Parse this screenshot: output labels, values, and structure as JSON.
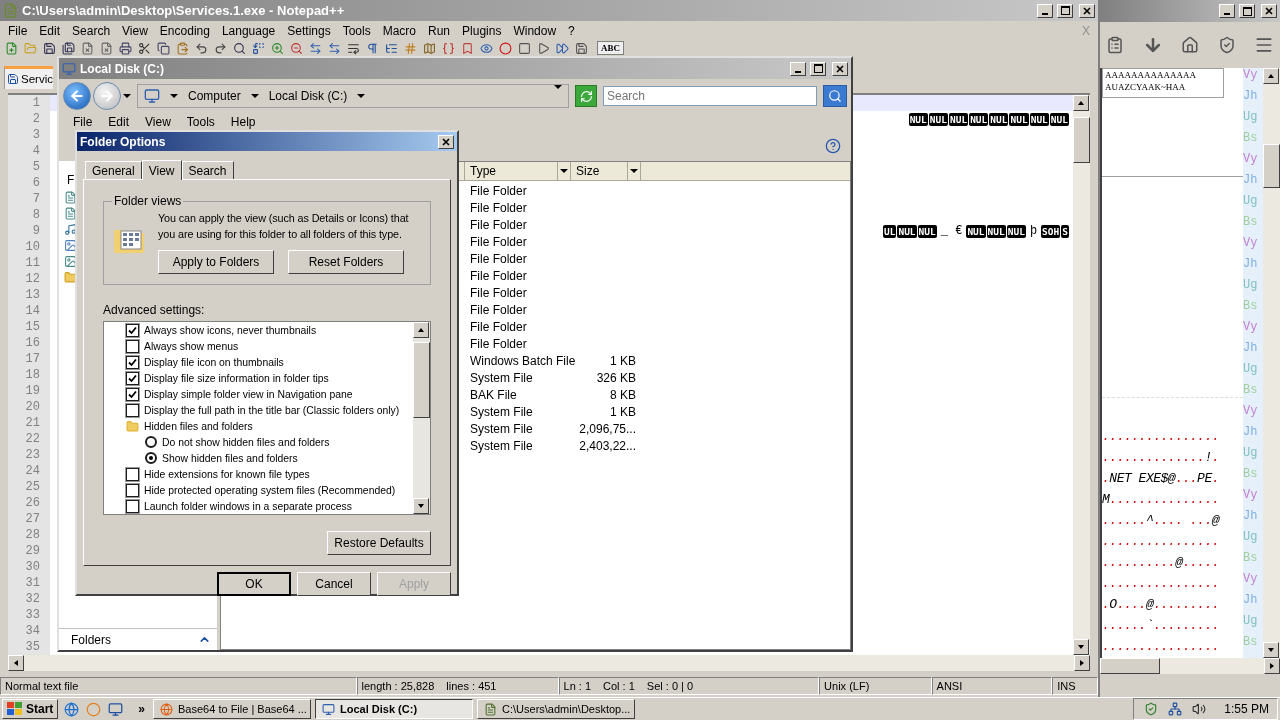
{
  "notepad": {
    "title": "C:\\Users\\admin\\Desktop\\Services.1.exe - Notepad++",
    "menu": [
      "File",
      "Edit",
      "Search",
      "View",
      "Encoding",
      "Language",
      "Settings",
      "Tools",
      "Macro",
      "Run",
      "Plugins",
      "Window",
      "?"
    ],
    "close_document": "X",
    "toolbar_label": "ABC",
    "tab": "Servic",
    "lines": [
      {
        "number": "1",
        "current": true
      },
      {
        "number": "2",
        "current": false,
        "tokens": [
          {
            "kind": "ctrl",
            "text": "NUL"
          },
          {
            "kind": "ctrl",
            "text": "NUL"
          },
          {
            "kind": "ctrl",
            "text": "NUL"
          },
          {
            "kind": "ctrl",
            "text": "NUL"
          },
          {
            "kind": "ctrl",
            "text": "NUL"
          },
          {
            "kind": "ctrl",
            "text": "NUL"
          },
          {
            "kind": "ctrl",
            "text": "NUL"
          },
          {
            "kind": "ctrl",
            "text": "NUL"
          }
        ]
      },
      {
        "number": "3",
        "current": false
      },
      {
        "number": "4",
        "current": false
      },
      {
        "number": "5",
        "current": false
      },
      {
        "number": "6",
        "current": false
      },
      {
        "number": "7",
        "current": false
      },
      {
        "number": "8",
        "current": false
      },
      {
        "number": "9",
        "current": false,
        "tokens": [
          {
            "kind": "ctrl",
            "text": "UL"
          },
          {
            "kind": "ctrl",
            "text": "NUL"
          },
          {
            "kind": "ctrl",
            "text": "NUL"
          },
          {
            "kind": "char",
            "text": "_ €"
          },
          {
            "kind": "ctrl",
            "text": "NUL"
          },
          {
            "kind": "ctrl",
            "text": "NUL"
          },
          {
            "kind": "ctrl",
            "text": "NUL"
          },
          {
            "kind": "char",
            "text": "þ"
          },
          {
            "kind": "ctrl",
            "text": "SOH"
          },
          {
            "kind": "ctrl",
            "text": "S"
          }
        ]
      },
      {
        "number": "10",
        "current": false
      },
      {
        "number": "11",
        "current": false
      },
      {
        "number": "12",
        "current": false
      },
      {
        "number": "13",
        "current": false
      },
      {
        "number": "14",
        "current": false
      },
      {
        "number": "15",
        "current": false
      },
      {
        "number": "16",
        "current": false
      },
      {
        "number": "17",
        "current": false
      },
      {
        "number": "18",
        "current": false
      },
      {
        "number": "19",
        "current": false
      },
      {
        "number": "20",
        "current": false
      },
      {
        "number": "21",
        "current": false
      },
      {
        "number": "22",
        "current": false
      },
      {
        "number": "23",
        "current": false
      },
      {
        "number": "24",
        "current": false
      },
      {
        "number": "25",
        "current": false
      },
      {
        "number": "26",
        "current": false
      },
      {
        "number": "27",
        "current": false
      },
      {
        "number": "28",
        "current": false
      },
      {
        "number": "29",
        "current": false
      },
      {
        "number": "30",
        "current": false
      },
      {
        "number": "31",
        "current": false
      },
      {
        "number": "32",
        "current": false
      },
      {
        "number": "33",
        "current": false
      },
      {
        "number": "34",
        "current": false
      },
      {
        "number": "35",
        "current": false
      }
    ],
    "status": [
      {
        "texts": [
          "Normal text file"
        ]
      },
      {
        "texts": [
          "length : 25,828",
          "lines : 451"
        ]
      },
      {
        "texts": [
          "Ln : 1",
          "Col : 1",
          "Sel : 0 | 0"
        ]
      },
      {
        "texts": [
          "Unix (LF)"
        ]
      },
      {
        "texts": [
          "ANSI"
        ]
      },
      {
        "texts": [
          "INS"
        ]
      }
    ]
  },
  "explorer": {
    "title": "Local Disk (C:)",
    "breadcrumb": [
      "Computer",
      "Local Disk (C:)"
    ],
    "search": {
      "placeholder": "Search"
    },
    "menu": [
      "File",
      "Edit",
      "View",
      "Tools",
      "Help"
    ],
    "nav_heading": "F",
    "folders_label": "Folders",
    "columns": [
      "Type",
      "Size"
    ],
    "rows": [
      {
        "type": "File Folder"
      },
      {
        "type": "File Folder"
      },
      {
        "type": "File Folder"
      },
      {
        "type": "File Folder"
      },
      {
        "type": "File Folder"
      },
      {
        "type": "File Folder"
      },
      {
        "type": "File Folder"
      },
      {
        "type": "File Folder"
      },
      {
        "type": "File Folder"
      },
      {
        "type": "File Folder"
      },
      {
        "type": "Windows Batch File",
        "size": "1 KB"
      },
      {
        "type": "System File",
        "size": "326 KB"
      },
      {
        "type": "BAK File",
        "size": "8 KB"
      },
      {
        "type": "System File",
        "size": "1 KB"
      },
      {
        "type": "System File",
        "size": "2,096,75..."
      },
      {
        "type": "System File",
        "size": "2,403,22..."
      }
    ]
  },
  "folder_options": {
    "title": "Folder Options",
    "tabs": [
      {
        "label": "General",
        "selected": false
      },
      {
        "label": "View",
        "selected": true
      },
      {
        "label": "Search",
        "selected": false
      }
    ],
    "group_title": "Folder views",
    "description": "You can apply the view (such as Details or Icons) that you are using for this folder to all folders of this type.",
    "group_buttons": [
      "Apply to Folders",
      "Reset Folders"
    ],
    "advanced_label": "Advanced settings:",
    "settings": [
      {
        "kind": "checkbox",
        "label": "Always show icons, never thumbnails",
        "checked": true
      },
      {
        "kind": "checkbox",
        "label": "Always show menus",
        "checked": false
      },
      {
        "kind": "checkbox",
        "label": "Display file icon on thumbnails",
        "checked": true
      },
      {
        "kind": "checkbox",
        "label": "Display file size information in folder tips",
        "checked": true
      },
      {
        "kind": "checkbox",
        "label": "Display simple folder view in Navigation pane",
        "checked": true
      },
      {
        "kind": "checkbox",
        "label": "Display the full path in the title bar (Classic folders only)",
        "checked": false
      },
      {
        "kind": "folder",
        "label": "Hidden files and folders",
        "children": [
          {
            "kind": "radio",
            "label": "Do not show hidden files and folders",
            "selected": false
          },
          {
            "kind": "radio",
            "label": "Show hidden files and folders",
            "selected": true
          }
        ]
      },
      {
        "kind": "checkbox",
        "label": "Hide extensions for known file types",
        "checked": false
      },
      {
        "kind": "checkbox",
        "label": "Hide protected operating system files (Recommended)",
        "checked": false
      },
      {
        "kind": "checkbox",
        "label": "Launch folder windows in a separate process",
        "checked": false
      }
    ],
    "restore_button": "Restore Defaults",
    "buttons": [
      {
        "label": "OK",
        "default": true,
        "disabled": false
      },
      {
        "label": "Cancel",
        "default": false,
        "disabled": false
      },
      {
        "label": "Apply",
        "default": false,
        "disabled": true
      }
    ]
  },
  "browser": {
    "textbox_lines": [
      "AAAAAAAAAAAAAA",
      "AUAZCYAAK~HAA"
    ],
    "dump_rows": [
      "................",
      "..............!.",
      ".NET EXE$@...PE.",
      "M...............",
      "......^.... ...@",
      "................",
      "..........@.....",
      "................",
      ".O....@.........",
      "......`.........",
      "................"
    ],
    "side_column": [
      "Vy",
      "Jh",
      "Ug",
      "Bs",
      "Vy",
      "Jh",
      "Ug",
      "Bs",
      "Vy",
      "Jh",
      "Ug",
      "Bs",
      "Vy",
      "Jh",
      "Ug",
      "Bs",
      "Vy",
      "Jh",
      "Ug",
      "Bs",
      "Vy",
      "Jh",
      "Ug",
      "Bs",
      "Vy",
      "Jh",
      "Ug",
      "Bs"
    ]
  },
  "taskbar": {
    "start": "Start",
    "overflow": "»",
    "tasks": [
      {
        "kind": "browser",
        "label": "Base64 to File | Base64 ...",
        "selected": false
      },
      {
        "kind": "explorer",
        "label": "Local Disk (C:)",
        "selected": true
      },
      {
        "kind": "notepad",
        "label": "C:\\Users\\admin\\Desktop...",
        "selected": false
      }
    ],
    "clock": "1:55 PM"
  }
}
